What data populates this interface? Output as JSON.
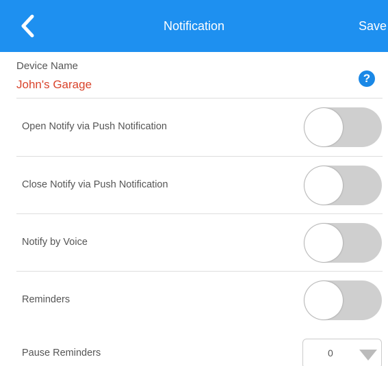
{
  "header": {
    "title": "Notification",
    "save_label": "Save",
    "back_icon": "chevron-left-icon",
    "bg_color": "#1e90f0"
  },
  "device": {
    "label": "Device Name",
    "value": "John's Garage",
    "value_color": "#d9432b",
    "help_icon": "question-circle-icon",
    "help_glyph": "?"
  },
  "settings": [
    {
      "label": "Open Notify via Push Notification",
      "enabled": false
    },
    {
      "label": "Close Notify via Push Notification",
      "enabled": false
    },
    {
      "label": "Notify by Voice",
      "enabled": false
    },
    {
      "label": "Reminders",
      "enabled": false
    }
  ],
  "pause_reminders": {
    "label": "Pause Reminders",
    "selected": "0",
    "arrow_icon": "dropdown-arrow-icon"
  }
}
